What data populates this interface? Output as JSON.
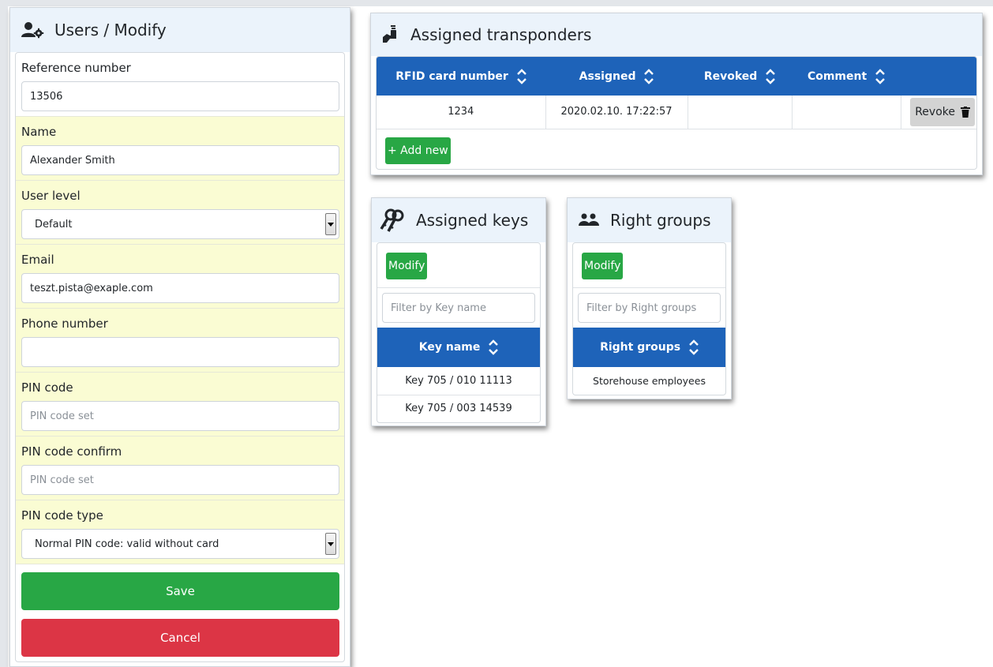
{
  "form": {
    "title": "Users / Modify",
    "reference_label": "Reference number",
    "reference_value": "13506",
    "name_label": "Name",
    "name_value": "Alexander Smith",
    "user_level_label": "User level",
    "user_level_value": "Default",
    "email_label": "Email",
    "email_value": "teszt.pista@exaple.com",
    "phone_label": "Phone number",
    "phone_value": "",
    "pin_label": "PIN code",
    "pin_placeholder": "PIN code set",
    "pin_confirm_label": "PIN code confirm",
    "pin_confirm_placeholder": "PIN code set",
    "pin_type_label": "PIN code type",
    "pin_type_value": "Normal PIN code: valid without card",
    "save_label": "Save",
    "cancel_label": "Cancel"
  },
  "transponders": {
    "title": "Assigned transponders",
    "columns": [
      "RFID card number",
      "Assigned",
      "Revoked",
      "Comment"
    ],
    "rows": [
      {
        "card": "1234",
        "assigned": "2020.02.10. 17:22:57",
        "revoked": "",
        "comment": ""
      }
    ],
    "revoke_label": "Revoke",
    "add_label": "+ Add new"
  },
  "keys": {
    "title": "Assigned keys",
    "modify_label": "Modify",
    "filter_placeholder": "Filter by Key name",
    "column": "Key name",
    "rows": [
      "Key 705 / 010 11113",
      "Key 705 / 003 14539"
    ]
  },
  "groups": {
    "title": "Right groups",
    "modify_label": "Modify",
    "filter_placeholder": "Filter by Right groups",
    "column": "Right groups",
    "rows": [
      "Storehouse employees"
    ]
  },
  "colors": {
    "primary": "#1e63b9",
    "success": "#28a745",
    "danger": "#dc3545",
    "header_bg": "#ebf3fb",
    "field_highlight": "#fafcd3"
  }
}
